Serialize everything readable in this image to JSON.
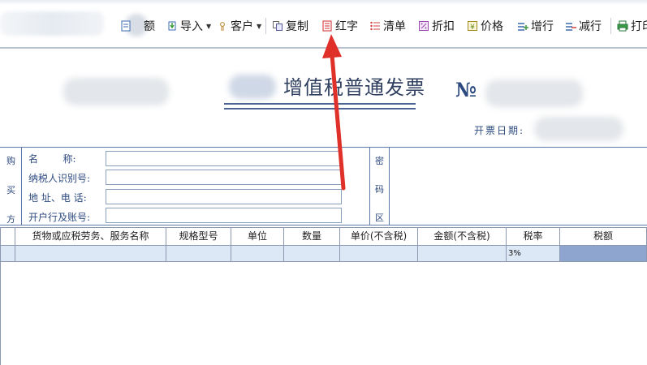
{
  "toolbar": {
    "items": [
      {
        "label": "额"
      },
      {
        "label": "导入"
      },
      {
        "label": "客户"
      },
      {
        "label": "复制"
      },
      {
        "label": "红字"
      },
      {
        "label": "清单"
      },
      {
        "label": "折扣"
      },
      {
        "label": "价格"
      },
      {
        "label": "增行"
      },
      {
        "label": "减行"
      },
      {
        "label": "打印"
      }
    ]
  },
  "invoice": {
    "title": "增值税普通发票",
    "number_label": "№",
    "date_label": "开票日期:"
  },
  "buyer": {
    "side_label": [
      "购",
      "买",
      "方"
    ],
    "fields": [
      {
        "label": "名        称:"
      },
      {
        "label": "纳税人识别号:"
      },
      {
        "label": "地 址、电 话:"
      },
      {
        "label": "开户行及账号:"
      }
    ],
    "cipher_label": [
      "密",
      "码",
      "区"
    ]
  },
  "items_table": {
    "columns": [
      "货物或应税劳务、服务名称",
      "规格型号",
      "单位",
      "数量",
      "单价(不含税)",
      "金额(不含税)",
      "税率",
      "税额"
    ],
    "rows": [
      {
        "name": "",
        "spec": "",
        "unit": "",
        "qty": "",
        "price": "",
        "amount": "",
        "rate": "3%",
        "tax": ""
      }
    ]
  },
  "colors": {
    "accent_blue": "#2d4a80",
    "arrow_red": "#e0302a",
    "selected_row": "#dce8f5",
    "tax_cell": "#8ea6cf"
  }
}
